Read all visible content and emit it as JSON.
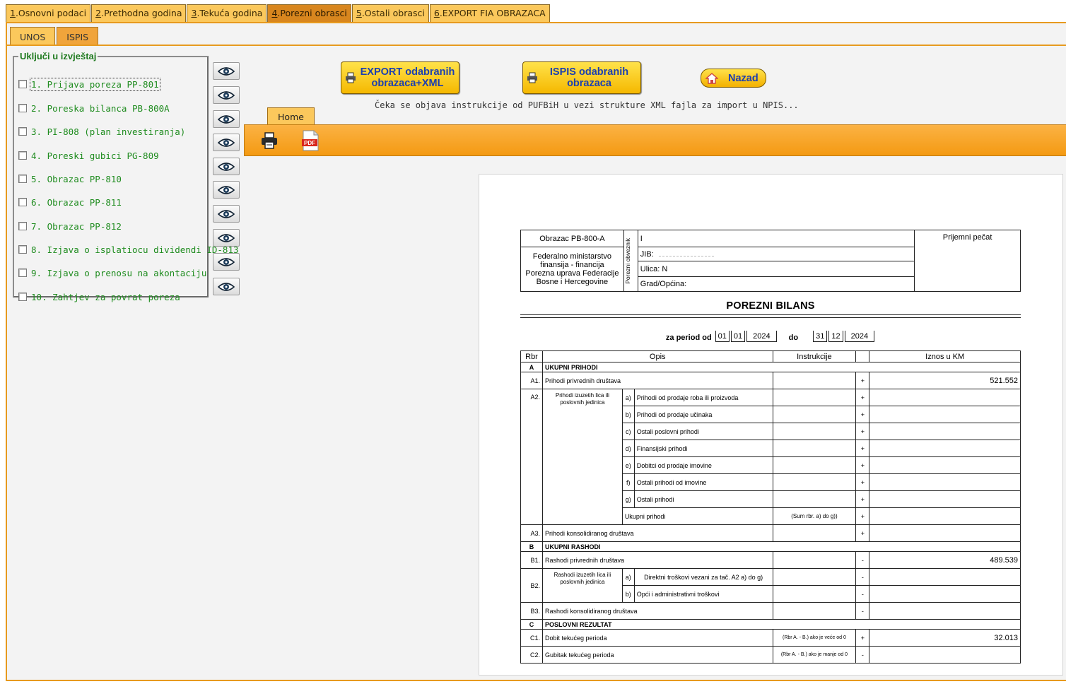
{
  "top_tabs": [
    {
      "num": "1",
      "label": ".Osnovni podaci"
    },
    {
      "num": "2",
      "label": ".Prethodna godina"
    },
    {
      "num": "3",
      "label": ".Tekuća godina"
    },
    {
      "num": "4",
      "label": ".Porezni obrasci"
    },
    {
      "num": "5",
      "label": ".Ostali obrasci"
    },
    {
      "num": "6",
      "label": ".EXPORT FIA OBRAZACA"
    }
  ],
  "sub_tabs": [
    "UNOS",
    "ISPIS"
  ],
  "group_title": "Uključi u izvještaj",
  "forms": [
    "1. Prijava poreza PP-801",
    "2. Poreska bilanca PB-800A",
    "3. PI-808 (plan investiranja)",
    "4. Poreski gubici PG-809",
    "5. Obrazac PP-810",
    "6. Obrazac PP-811",
    "7. Obrazac PP-812",
    "8. Izjava o isplatiocu dividendi ID-813",
    "9. Izjava o prenosu na akontaciju",
    "10. Zahtjev za povrat poreza"
  ],
  "buttons": {
    "export_line1": "EXPORT odabranih",
    "export_line2": "obrazaca+XML",
    "ispis_line1": "ISPIS odabranih",
    "ispis_line2": "obrazaca",
    "nazad": "Nazad"
  },
  "note": "Čeka se objava instrukcije od PUFBiH u vezi strukture XML fajla za import u NPIS...",
  "home_tab": "Home",
  "icons": {
    "print": "printer-icon",
    "pdf": "pdf-icon",
    "preview": "eye-icon"
  },
  "colors": {
    "accent": "#f49a12",
    "tab": "#fbc85c",
    "button": "#ffd21f",
    "button_text": "#1c3fb0",
    "green_text": "#1f8c1f"
  },
  "report": {
    "form_code": "Obrazac PB-800-A",
    "ministry": [
      "Federalno ministarstvo",
      "finansija - financija",
      "Porezna uprava Federacije",
      "Bosne i Hercegovine"
    ],
    "side_label": "Porezni obveznik",
    "name_field": "I",
    "jib_label": "JIB: ",
    "street_label": "Ulica: N",
    "city_label": "Grad/Općina:",
    "stamp_label": "Prijemni pečat",
    "title": "POREZNI BILANS",
    "period_label": "za period od",
    "period_to": "do",
    "from": {
      "d": "01",
      "m": "01",
      "y": "2024"
    },
    "to": {
      "d": "31",
      "m": "12",
      "y": "2024"
    },
    "col_rbr": "Rbr",
    "col_opis": "Opis",
    "col_instr": "Instrukcije",
    "col_iznos": "Iznos u KM",
    "secA": {
      "code": "A",
      "label": "UKUPNI PRIHODI"
    },
    "a1": {
      "code": "A1.",
      "label": "Prihodi privrednih društava",
      "sign": "+",
      "value": "521.552"
    },
    "a2": {
      "code": "A2.",
      "label": "Prihodi izuzetih lica ili poslovnih jedinica"
    },
    "a2_rows": [
      {
        "k": "a)",
        "label": "Prihodi od prodaje roba ili proizvoda",
        "sign": "+"
      },
      {
        "k": "b)",
        "label": "Prihodi od prodaje učinaka",
        "sign": "+"
      },
      {
        "k": "c)",
        "label": "Ostali poslovni prihodi",
        "sign": "+"
      },
      {
        "k": "d)",
        "label": "Finansijski prihodi",
        "sign": "+"
      },
      {
        "k": "e)",
        "label": "Dobitci od prodaje imovine",
        "sign": "+"
      },
      {
        "k": "f)",
        "label": "Ostali prihodi od imovine",
        "sign": "+"
      },
      {
        "k": "g)",
        "label": "Ostali prihodi",
        "sign": "+"
      }
    ],
    "a2_total": {
      "label": "Ukupni prihodi",
      "instr": "(Sum rbr. a) do g))",
      "sign": "+"
    },
    "a3": {
      "code": "A3.",
      "label": "Prihodi konsolidiranog društava",
      "sign": "+"
    },
    "secB": {
      "code": "B",
      "label": "UKUPNI RASHODI"
    },
    "b1": {
      "code": "B1.",
      "label": "Rashodi privrednih društava",
      "sign": "-",
      "value": "489.539"
    },
    "b2": {
      "code": "B2.",
      "label": "Rashodi izuzetih lica ili poslovnih jedinica"
    },
    "b2_rows": [
      {
        "k": "a)",
        "label": "Direktni troškovi vezani za tač. A2 a) do g)",
        "sign": "-"
      },
      {
        "k": "b)",
        "label": "Opći i administrativni troškovi",
        "sign": "-"
      }
    ],
    "b3": {
      "code": "B3.",
      "label": "Rashodi konsolidiranog društava",
      "sign": "-"
    },
    "secC": {
      "code": "C",
      "label": "POSLOVNI REZULTAT"
    },
    "c1": {
      "code": "C1.",
      "label": "Dobit tekućeg perioda",
      "instr": "(Rbr A. - B.) ako je veće od 0",
      "sign": "+",
      "value": "32.013"
    },
    "c2": {
      "code": "C2.",
      "label": "Gubitak tekućeg perioda",
      "instr": "(Rbr A. - B.) ako je manje od 0",
      "sign": "-"
    }
  }
}
